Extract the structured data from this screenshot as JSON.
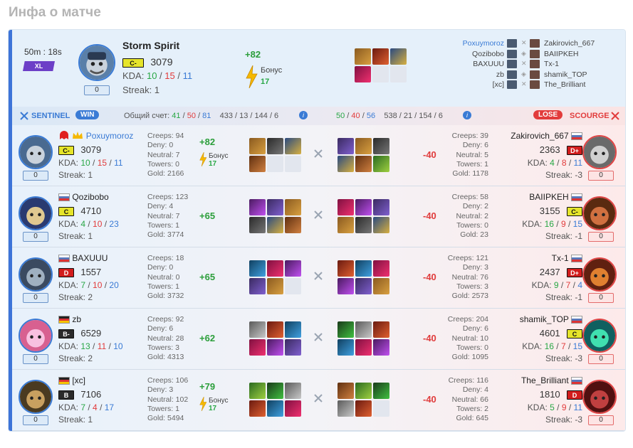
{
  "page_title": "Инфа о матче",
  "summary": {
    "time": "50m : 18s",
    "mode": "XL",
    "hero_name": "Storm Spirit",
    "rank": "C-",
    "mmr": "3079",
    "kda_label": "KDA:",
    "k": "10",
    "d": "15",
    "a": "11",
    "streak": "Streak: 1",
    "mmr_box": "0",
    "gain": "+82",
    "bonus_label": "Бонус",
    "bonus_value": "17",
    "sentinel_list": [
      "Poxuymoroz",
      "Qozibobo",
      "BAXUUU",
      "zb",
      "[xc]"
    ],
    "scourge_list": [
      "Zakirovich_667",
      "BAIIPKEH",
      "Tx-1",
      "shamik_TOP",
      "The_Brilliant"
    ]
  },
  "scoreline": {
    "sentinel_label": "SENTINEL",
    "win_label": "WIN",
    "score_label": "Общий счет:",
    "s_k": "41",
    "s_d": "50",
    "s_a": "81",
    "s_totals": "433 / 13 / 144 / 6",
    "r_k": "50",
    "r_d": "40",
    "r_a": "56",
    "r_totals": "538 / 21 / 154 / 6",
    "lose_label": "LOSE",
    "scourge_label": "SCOURGE"
  },
  "colors": {
    "sentinel": "#3a7bd5",
    "scourge": "#e23c3c",
    "gain": "#28a745",
    "loss": "#e03b3b"
  },
  "rows": [
    {
      "left": {
        "name": "Poxuymoroz",
        "rank": "C-",
        "mmr": "3079",
        "k": "10",
        "d": "15",
        "a": "11",
        "streak": "Streak: 1",
        "box": "0",
        "creeps": "Creeps: 94",
        "deny": "Deny: 0",
        "neutral": "Neutral: 7",
        "towers": "Towers: 0",
        "gold": "Gold: 2166",
        "gain": "+82",
        "bonus_label": "Бонус",
        "bonus": "17"
      },
      "right": {
        "name": "Zakirovich_667",
        "rank": "D+",
        "mmr": "2363",
        "k": "4",
        "d": "8",
        "a": "11",
        "streak": "Streak: -3",
        "box": "0",
        "creeps": "Creeps: 39",
        "deny": "Deny: 6",
        "neutral": "Neutral: 5",
        "towers": "Towers: 1",
        "gold": "Gold: 1178",
        "loss": "-40"
      }
    },
    {
      "left": {
        "name": "Qozibobo",
        "rank": "C",
        "mmr": "4710",
        "k": "4",
        "d": "10",
        "a": "23",
        "streak": "Streak: 1",
        "box": "0",
        "creeps": "Creeps: 123",
        "deny": "Deny: 4",
        "neutral": "Neutral: 7",
        "towers": "Towers: 1",
        "gold": "Gold: 3774",
        "gain": "+65"
      },
      "right": {
        "name": "BAIIPKEH",
        "rank": "C-",
        "mmr": "3155",
        "k": "16",
        "d": "9",
        "a": "15",
        "streak": "Streak: -1",
        "box": "0",
        "creeps": "Creeps: 58",
        "deny": "Deny: 2",
        "neutral": "Neutral: 2",
        "towers": "Towers: 0",
        "gold": "Gold: 23",
        "loss": "-40"
      }
    },
    {
      "left": {
        "name": "BAXUUU",
        "rank": "D",
        "mmr": "1557",
        "k": "7",
        "d": "10",
        "a": "20",
        "streak": "Streak: 2",
        "box": "0",
        "creeps": "Creeps: 18",
        "deny": "Deny: 0",
        "neutral": "Neutral: 0",
        "towers": "Towers: 1",
        "gold": "Gold: 3732",
        "gain": "+65"
      },
      "right": {
        "name": "Tx-1",
        "rank": "D+",
        "mmr": "2437",
        "k": "9",
        "d": "7",
        "a": "4",
        "streak": "Streak: -1",
        "box": "0",
        "creeps": "Creeps: 121",
        "deny": "Deny: 3",
        "neutral": "Neutral: 76",
        "towers": "Towers: 3",
        "gold": "Gold: 2573",
        "loss": "-40"
      }
    },
    {
      "left": {
        "name": "zb",
        "rank": "B-",
        "mmr": "6529",
        "k": "13",
        "d": "11",
        "a": "10",
        "streak": "Streak: 2",
        "box": "0",
        "creeps": "Creeps: 92",
        "deny": "Deny: 6",
        "neutral": "Neutral: 28",
        "towers": "Towers: 3",
        "gold": "Gold: 4313",
        "gain": "+62"
      },
      "right": {
        "name": "shamik_TOP",
        "rank": "C",
        "mmr": "4601",
        "k": "16",
        "d": "7",
        "a": "15",
        "streak": "Streak: -3",
        "box": "0",
        "creeps": "Creeps: 204",
        "deny": "Deny: 6",
        "neutral": "Neutral: 10",
        "towers": "Towers: 0",
        "gold": "Gold: 1095",
        "loss": "-40"
      }
    },
    {
      "left": {
        "name": "[xc]",
        "rank": "B",
        "mmr": "7106",
        "k": "7",
        "d": "4",
        "a": "17",
        "streak": "Streak: 1",
        "box": "0",
        "creeps": "Creeps: 106",
        "deny": "Deny: 3",
        "neutral": "Neutral: 102",
        "towers": "Towers: 1",
        "gold": "Gold: 5494",
        "gain": "+79",
        "bonus_label": "Бонус",
        "bonus": "17"
      },
      "right": {
        "name": "The_Brilliant",
        "rank": "D",
        "mmr": "1810",
        "k": "5",
        "d": "9",
        "a": "11",
        "streak": "Streak: -3",
        "box": "0",
        "creeps": "Creeps: 116",
        "deny": "Deny: 4",
        "neutral": "Neutral: 66",
        "towers": "Towers: 2",
        "gold": "Gold: 645",
        "loss": "-40"
      }
    }
  ]
}
